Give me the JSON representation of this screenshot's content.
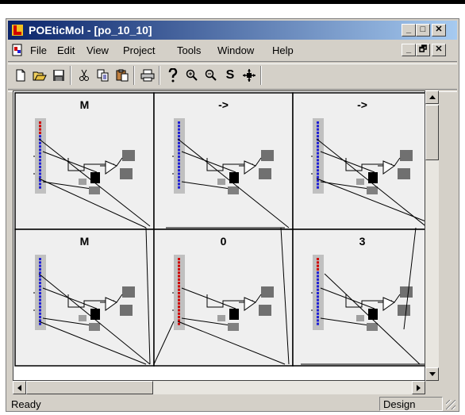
{
  "window": {
    "title": "POEticMol - [po_10_10]",
    "minimize_glyph": "_",
    "maximize_glyph": "□",
    "close_glyph": "✕"
  },
  "menu": {
    "items": [
      "File",
      "Edit",
      "View",
      "Project",
      "Tools",
      "Window",
      "Help"
    ],
    "mdi_minimize": "_",
    "mdi_restore": "🗗",
    "mdi_close": "✕"
  },
  "toolbar": {
    "buttons": [
      "new-icon",
      "open-icon",
      "save-icon",
      "cut-icon",
      "copy-icon",
      "paste-icon",
      "print-icon",
      "help-icon",
      "zoom-in-icon",
      "zoom-out-icon",
      "s-icon",
      "move-icon"
    ],
    "s_label": "S"
  },
  "canvas": {
    "cells": [
      {
        "label": "M",
        "bar_color": "#1f1fd6",
        "top_color": "#d00000"
      },
      {
        "label": "->",
        "bar_color": "#1f1fd6",
        "top_color": "#1f1fd6"
      },
      {
        "label": "->",
        "bar_color": "#1f1fd6",
        "top_color": "#1f1fd6"
      },
      {
        "label": "M",
        "bar_color": "#1f1fd6",
        "top_color": "#1f1fd6"
      },
      {
        "label": "0",
        "bar_color": "#d00000",
        "top_color": "#d00000"
      },
      {
        "label": "3",
        "bar_color": "#1f1fd6",
        "top_color": "#d00000"
      }
    ]
  },
  "status": {
    "text": "Ready",
    "mode": "Design"
  }
}
